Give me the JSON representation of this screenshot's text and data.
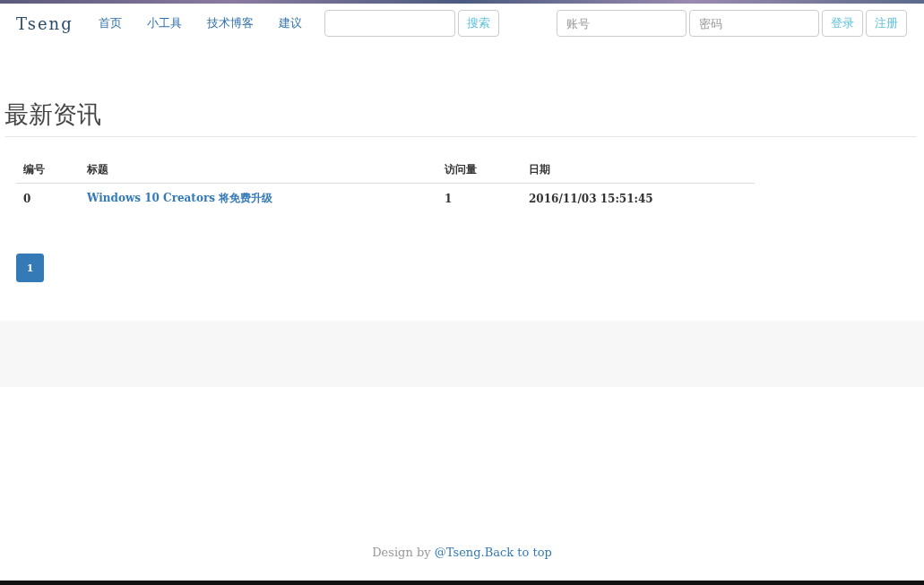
{
  "navbar": {
    "brand": "Tseng",
    "links": [
      "首页",
      "小工具",
      "技术博客",
      "建议"
    ],
    "search": {
      "button": "搜索"
    },
    "login": {
      "account_placeholder": "账号",
      "password_placeholder": "密码",
      "login_button": "登录",
      "register_button": "注册"
    }
  },
  "heading": "最新资讯",
  "table": {
    "columns": [
      "编号",
      "标题",
      "访问量",
      "日期"
    ],
    "rows": [
      {
        "id": "0",
        "title": "Windows 10 Creators 将免费升级",
        "views": "1",
        "date": "2016/11/03 15:51:45"
      }
    ]
  },
  "pagination": [
    {
      "label": "1",
      "selected": true
    }
  ],
  "footer": {
    "prefix": "Design by ",
    "link": "@Tseng.Back to top"
  }
}
